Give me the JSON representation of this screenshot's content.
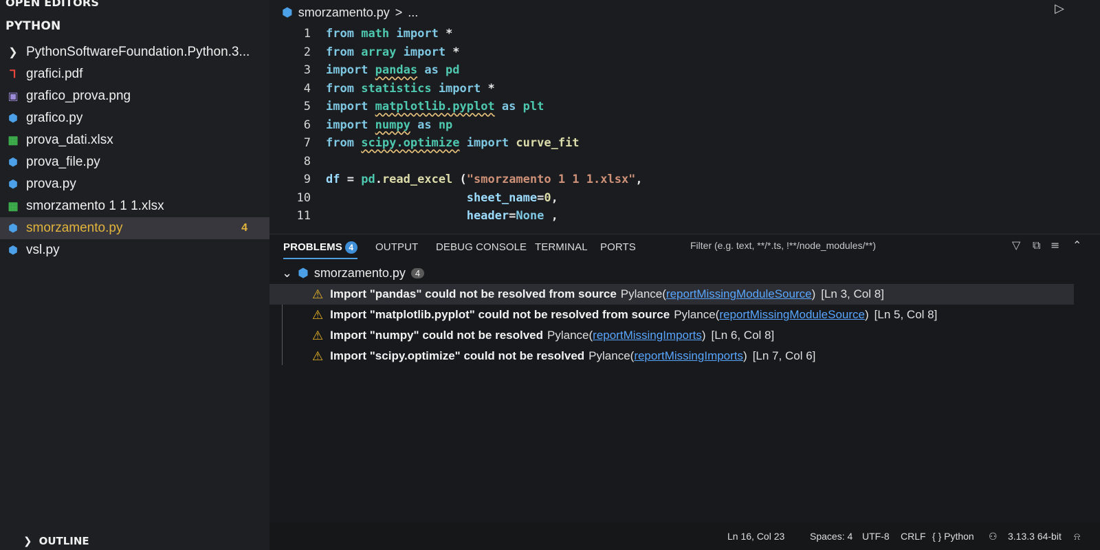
{
  "sidebar": {
    "open_editors": "OPEN EDITORS",
    "section": "PYTHON",
    "items": [
      {
        "label": "PythonSoftwareFoundation.Python.3...",
        "icon": "chevron-right-icon",
        "kind": "folder"
      },
      {
        "label": "grafici.pdf",
        "icon": "pdf-icon",
        "kind": "pdf"
      },
      {
        "label": "grafico_prova.png",
        "icon": "image-icon",
        "kind": "image"
      },
      {
        "label": "grafico.py",
        "icon": "python-icon",
        "kind": "python"
      },
      {
        "label": "prova_dati.xlsx",
        "icon": "excel-icon",
        "kind": "excel"
      },
      {
        "label": "prova_file.py",
        "icon": "python-icon",
        "kind": "python"
      },
      {
        "label": "prova.py",
        "icon": "python-icon",
        "kind": "python"
      },
      {
        "label": "smorzamento 1 1 1.xlsx",
        "icon": "excel-icon",
        "kind": "excel"
      },
      {
        "label": "smorzamento.py",
        "icon": "python-icon",
        "kind": "python",
        "selected": true,
        "badge": "4"
      },
      {
        "label": "vsl.py",
        "icon": "python-icon",
        "kind": "python"
      }
    ],
    "outline": "OUTLINE"
  },
  "editor": {
    "breadcrumb": {
      "file": "smorzamento.py",
      "sep": ">",
      "rest": "..."
    },
    "lines": [
      {
        "n": "1",
        "tokens": [
          [
            "from",
            "kw2"
          ],
          [
            " ",
            "plain"
          ],
          [
            "math",
            "mod"
          ],
          [
            " ",
            "plain"
          ],
          [
            "import",
            "kw2"
          ],
          [
            " *",
            "plain"
          ]
        ]
      },
      {
        "n": "2",
        "tokens": [
          [
            "from",
            "kw2"
          ],
          [
            " ",
            "plain"
          ],
          [
            "array",
            "mod"
          ],
          [
            " ",
            "plain"
          ],
          [
            "import",
            "kw2"
          ],
          [
            " *",
            "plain"
          ]
        ]
      },
      {
        "n": "3",
        "tokens": [
          [
            "import",
            "kw2"
          ],
          [
            " ",
            "plain"
          ],
          [
            "pandas",
            "mod wavy"
          ],
          [
            " as ",
            "kw2"
          ],
          [
            "pd",
            "mod"
          ]
        ]
      },
      {
        "n": "4",
        "tokens": [
          [
            "from",
            "kw2"
          ],
          [
            " ",
            "plain"
          ],
          [
            "statistics",
            "mod"
          ],
          [
            " ",
            "plain"
          ],
          [
            "import",
            "kw2"
          ],
          [
            " *",
            "plain"
          ]
        ]
      },
      {
        "n": "5",
        "tokens": [
          [
            "import",
            "kw2"
          ],
          [
            " ",
            "plain"
          ],
          [
            "matplotlib.pyplot",
            "mod wavy"
          ],
          [
            " as ",
            "kw2"
          ],
          [
            "plt",
            "mod"
          ]
        ]
      },
      {
        "n": "6",
        "tokens": [
          [
            "import",
            "kw2"
          ],
          [
            " ",
            "plain"
          ],
          [
            "numpy",
            "mod wavy"
          ],
          [
            " as ",
            "kw2"
          ],
          [
            "np",
            "mod"
          ]
        ]
      },
      {
        "n": "7",
        "tokens": [
          [
            "from",
            "kw2"
          ],
          [
            " ",
            "plain"
          ],
          [
            "scipy.optimize",
            "mod wavy"
          ],
          [
            " ",
            "plain"
          ],
          [
            "import",
            "kw2"
          ],
          [
            " ",
            "plain"
          ],
          [
            "curve_fit",
            "fn"
          ]
        ]
      },
      {
        "n": "8",
        "tokens": []
      },
      {
        "n": "9",
        "tokens": [
          [
            "df",
            "var"
          ],
          [
            " = ",
            "plain"
          ],
          [
            "pd",
            "mod"
          ],
          [
            ".",
            "plain"
          ],
          [
            "read_excel",
            "fn"
          ],
          [
            " (",
            "plain"
          ],
          [
            "\"smorzamento 1 1 1.xlsx\"",
            "str"
          ],
          [
            ",",
            "plain"
          ]
        ]
      },
      {
        "n": "10",
        "tokens": [
          [
            "                    ",
            "plain"
          ],
          [
            "sheet_name",
            "var"
          ],
          [
            "=",
            "plain"
          ],
          [
            "0",
            "fn"
          ],
          [
            ",",
            "plain"
          ]
        ]
      },
      {
        "n": "11",
        "tokens": [
          [
            "                    ",
            "plain"
          ],
          [
            "header",
            "var"
          ],
          [
            "=",
            "plain"
          ],
          [
            "None",
            "kw2"
          ],
          [
            " ,",
            "plain"
          ]
        ]
      }
    ]
  },
  "panel": {
    "tabs": [
      {
        "label": "PROBLEMS",
        "badge": "4",
        "active": true
      },
      {
        "label": "OUTPUT"
      },
      {
        "label": "DEBUG CONSOLE"
      },
      {
        "label": "TERMINAL"
      },
      {
        "label": "PORTS"
      }
    ],
    "filter_placeholder": "Filter (e.g. text, **/*.ts, !**/node_modules/**)",
    "file": "smorzamento.py",
    "file_count": "4",
    "problems": [
      {
        "message": "Import \"pandas\" could not be resolved from source",
        "source": "Pylance(",
        "code": "reportMissingModuleSource",
        "close": ")",
        "location": "[Ln 3, Col 8]"
      },
      {
        "message": "Import \"matplotlib.pyplot\" could not be resolved from source",
        "source": "Pylance(",
        "code": "reportMissingModuleSource",
        "close": ")",
        "location": "[Ln 5, Col 8]"
      },
      {
        "message": "Import \"numpy\" could not be resolved",
        "source": "Pylance(",
        "code": "reportMissingImports",
        "close": ")",
        "location": "[Ln 6, Col 8]"
      },
      {
        "message": "Import \"scipy.optimize\" could not be resolved",
        "source": "Pylance(",
        "code": "reportMissingImports",
        "close": ")",
        "location": "[Ln 7, Col 6]"
      }
    ]
  },
  "statusbar": {
    "position": "Ln 16, Col 23",
    "spaces": "Spaces: 4",
    "encoding": "UTF-8",
    "eol": "CRLF",
    "language": "{ } Python",
    "interpreter": "3.13.3 64-bit"
  }
}
